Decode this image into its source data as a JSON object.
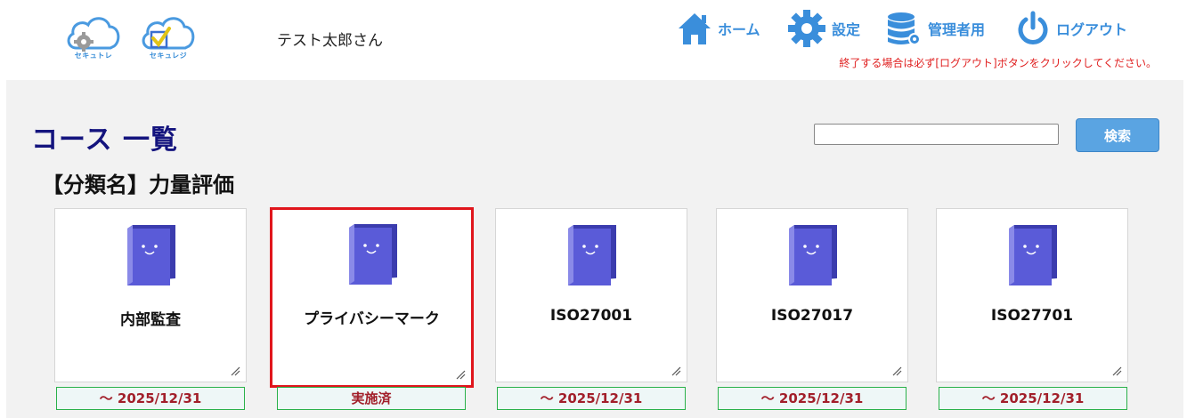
{
  "header": {
    "logos": [
      {
        "name": "セキュトレ",
        "icon": "cloud-gear-icon"
      },
      {
        "name": "セキュレジ",
        "icon": "cloud-checkbox-icon"
      }
    ],
    "username": "テスト太郎さん",
    "nav": {
      "home": {
        "label": "ホーム",
        "icon": "home-icon"
      },
      "settings": {
        "label": "設定",
        "icon": "gear-icon"
      },
      "admin": {
        "label": "管理者用",
        "icon": "database-icon"
      },
      "logout": {
        "label": "ログアウト",
        "icon": "power-icon"
      }
    },
    "logout_note": "終了する場合は必ず[ログアウト]ボタンをクリックしてください。"
  },
  "main": {
    "title": "コース 一覧",
    "search": {
      "value": "",
      "button_label": "検索"
    },
    "category_label": "【分類名】力量評価",
    "courses": [
      {
        "name": "内部監査",
        "status": "～ 2025/12/31",
        "selected": false
      },
      {
        "name": "プライバシーマーク",
        "status": "実施済",
        "selected": true
      },
      {
        "name": "ISO27001",
        "status": "～ 2025/12/31",
        "selected": false
      },
      {
        "name": "ISO27017",
        "status": "～ 2025/12/31",
        "selected": false
      },
      {
        "name": "ISO27701",
        "status": "～ 2025/12/31",
        "selected": false
      }
    ]
  },
  "colors": {
    "accent": "#3a8edb",
    "title": "#14147e",
    "warning": "#e02020",
    "status_text": "#a21f2a",
    "badge_border": "#2ab14a",
    "selected_border": "#e0151c",
    "book": "#5a5bd8"
  }
}
